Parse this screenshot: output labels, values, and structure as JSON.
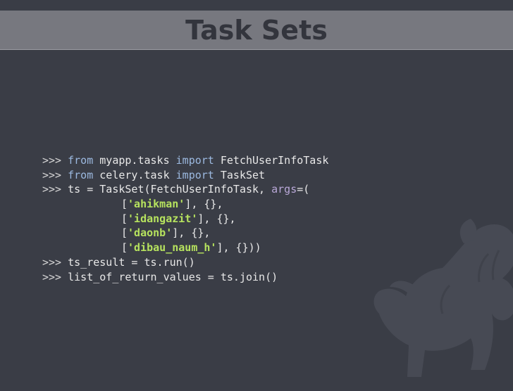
{
  "slide": {
    "title": "Task Sets"
  },
  "code": {
    "prompt": ">>>",
    "line1": {
      "kw1": "from",
      "module": "myapp.tasks",
      "kw2": "import",
      "name": "FetchUserInfoTask"
    },
    "line2": {
      "kw1": "from",
      "module": "celery.task",
      "kw2": "import",
      "name": "TaskSet"
    },
    "line3": {
      "pre": "ts = TaskSet(FetchUserInfoTask, ",
      "arg": "args",
      "post": "=("
    },
    "args": [
      {
        "open": "[",
        "str": "'ahikman'",
        "close": "], {},"
      },
      {
        "open": "[",
        "str": "'idangazit'",
        "close": "], {},"
      },
      {
        "open": "[",
        "str": "'daonb'",
        "close": "], {},"
      },
      {
        "open": "[",
        "str": "'dibau_naum_h'",
        "close": "], {}))"
      }
    ],
    "line8": "ts_result = ts.run()",
    "line9": "list_of_return_values = ts.join()"
  },
  "colors": {
    "background": "#3a3d46",
    "title_bar": "#77787f",
    "title_text": "#33353d",
    "keyword": "#9cb9e0",
    "string": "#b6e25e",
    "argname": "#b9a8d8"
  },
  "decoration": {
    "mascot_icon": "celery-pony-icon"
  }
}
